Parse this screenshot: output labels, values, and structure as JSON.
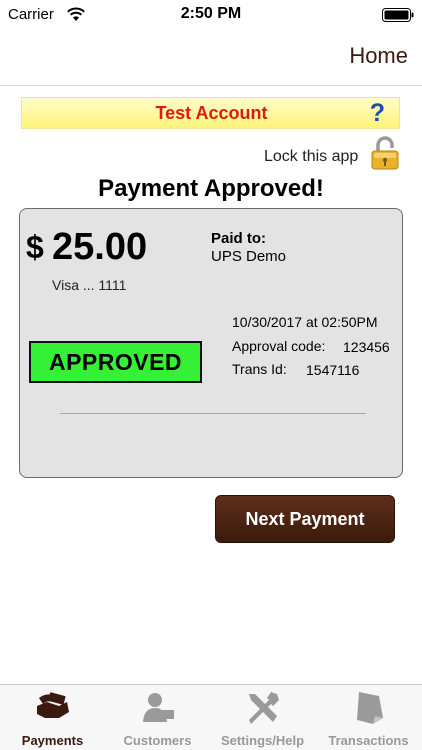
{
  "status_bar": {
    "carrier": "Carrier",
    "time": "2:50 PM"
  },
  "nav": {
    "home_label": "Home"
  },
  "banner": {
    "title": "Test Account",
    "help_symbol": "?"
  },
  "lock": {
    "label": "Lock this app",
    "icon": "padlock-icon"
  },
  "payment": {
    "heading": "Payment Approved!",
    "currency_symbol": "$",
    "amount": "25.00",
    "card": "Visa ... 1111",
    "paid_to_label": "Paid to:",
    "paid_to_name": "UPS Demo",
    "date_time": "10/30/2017 at 02:50PM",
    "approval_code_label": "Approval code:",
    "approval_code": "123456",
    "trans_id_label": "Trans Id:",
    "trans_id": "1547116",
    "status_badge": "APPROVED"
  },
  "actions": {
    "next_payment": "Next Payment"
  },
  "tabs": [
    {
      "label": "Payments",
      "icon": "payments-icon",
      "active": true
    },
    {
      "label": "Customers",
      "icon": "customers-icon",
      "active": false
    },
    {
      "label": "Settings/Help",
      "icon": "settings-tools-icon",
      "active": false
    },
    {
      "label": "Transactions",
      "icon": "transactions-icon",
      "active": false
    }
  ],
  "colors": {
    "accent": "#3a1a10",
    "approved_badge": "#36f036",
    "banner_text": "#dd1a1a",
    "help": "#1c4fb0"
  }
}
